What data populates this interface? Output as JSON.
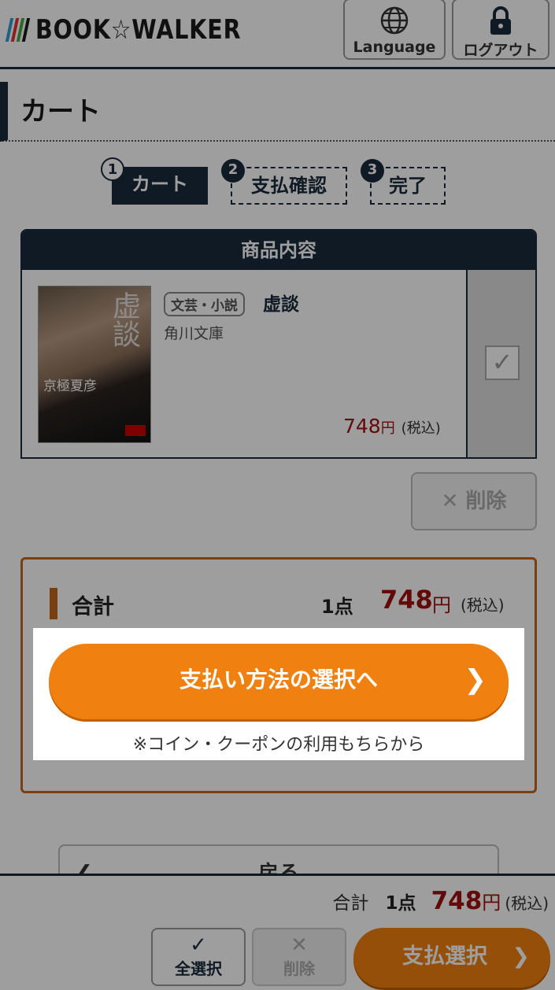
{
  "header": {
    "logo_text": "BOOK☆WALKER",
    "logo_bar_colors": [
      "#2a9fd6",
      "#e3312d",
      "#4aa845",
      "#1a1a1a"
    ],
    "language_label": "Language",
    "logout_label": "ログアウト"
  },
  "page": {
    "title": "カート"
  },
  "steps": [
    {
      "num": "1",
      "label": "カート"
    },
    {
      "num": "2",
      "label": "支払確認"
    },
    {
      "num": "3",
      "label": "完了"
    }
  ],
  "product_section": {
    "heading": "商品内容",
    "item": {
      "cover_title": "虚談",
      "cover_author": "京極夏彦",
      "genre": "文芸・小説",
      "title": "虚談",
      "publisher": "角川文庫",
      "price": "748",
      "currency": "円",
      "tax_note": "(税込)",
      "checked": true
    },
    "delete_label": "削除"
  },
  "summary": {
    "label": "合計",
    "count": "1点",
    "total": "748",
    "currency": "円",
    "tax_note": "(税込)",
    "pay_button": "支払い方法の選択へ",
    "coin_note": "※コイン・クーポンの利用もちらから",
    "back_button": "戻る"
  },
  "footer": {
    "label": "合計",
    "count": "1点",
    "total": "748",
    "currency": "円",
    "tax_note": "(税込)",
    "select_all_label": "全選択",
    "delete_label": "削除",
    "pay_label": "支払選択"
  },
  "colors": {
    "navy": "#1a2b3c",
    "orange": "#f08010",
    "price_red": "#a01010",
    "summary_border": "#c2661b"
  }
}
